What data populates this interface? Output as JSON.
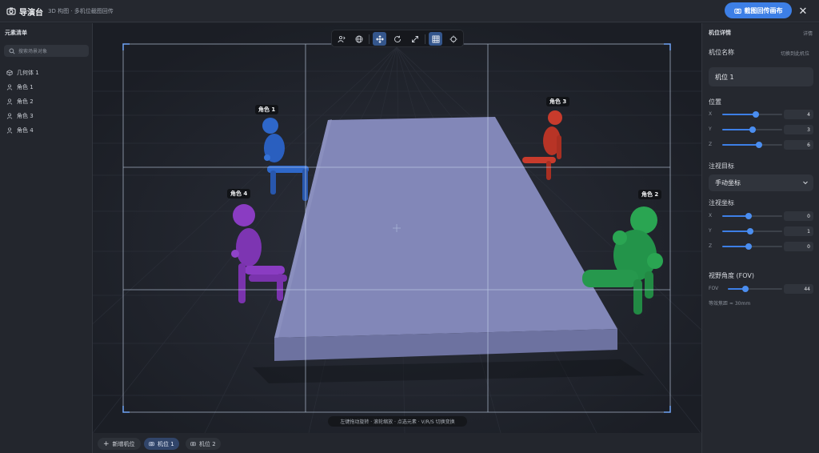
{
  "app": {
    "title": "导演台",
    "subtitle": "3D 构图 · 多机位截图回传",
    "primary_button": "截图回传画布",
    "close_label": "✕"
  },
  "left_panel": {
    "title": "元素清单",
    "search_placeholder": "搜索场景对象",
    "items": [
      {
        "label": "几何体 1",
        "icon": "cube-icon"
      },
      {
        "label": "角色 1",
        "icon": "person-icon"
      },
      {
        "label": "角色 2",
        "icon": "person-icon"
      },
      {
        "label": "角色 3",
        "icon": "person-icon"
      },
      {
        "label": "角色 4",
        "icon": "person-icon"
      }
    ]
  },
  "viewport": {
    "toolbar": [
      "person-move-icon",
      "globe-icon",
      "move-icon",
      "rotate-icon",
      "scale-icon",
      "grid-icon",
      "crosshair-icon"
    ],
    "active_tools": [
      "move-icon",
      "grid-icon"
    ],
    "labels": {
      "c1": "角色 1",
      "c2": "角色 2",
      "c3": "角色 3",
      "c4": "角色 4"
    },
    "hint": "左键拖动旋转 · 滚轮缩放 · 点选元素 · V/R/S 切换变换",
    "colors": {
      "c1": "#2e67c9",
      "c2": "#28a24e",
      "c3": "#c83b2c",
      "c4": "#8a3cc2",
      "table": "#7a7fb0"
    }
  },
  "bottom_bar": {
    "add_label": "新增机位",
    "cameras": [
      {
        "label": "机位 1",
        "active": true
      },
      {
        "label": "机位 2",
        "active": false
      }
    ]
  },
  "right_panel": {
    "title": "机位详情",
    "badge": "详情",
    "name_label": "机位名称",
    "switch_label": "切换到此机位",
    "name_value": "机位 1",
    "position_label": "位置",
    "position": {
      "x": "4",
      "y": "3",
      "z": "6"
    },
    "target_label": "注视目标",
    "target_value": "手动坐标",
    "look_label": "注视坐标",
    "look": {
      "x": "0",
      "y": "1",
      "z": "0"
    },
    "fov_label": "视野角度 (FOV)",
    "fov_axis": "FOV",
    "fov_value": "44",
    "focal_note": "等效焦距 ≈ 30mm",
    "axis_x": "X",
    "axis_y": "Y",
    "axis_z": "Z"
  }
}
